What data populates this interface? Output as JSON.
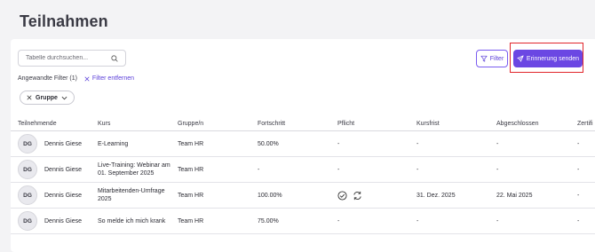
{
  "page": {
    "title": "Teilnahmen"
  },
  "toolbar": {
    "search_placeholder": "Tabelle durchsuchen...",
    "filter_label": "Filter",
    "send_reminder_label": "Erinnerung senden"
  },
  "filters": {
    "applied_label": "Angewandte Filter (1)",
    "clear_label": "Filter entfernen",
    "chips": [
      "Gruppe"
    ]
  },
  "table": {
    "columns": [
      "Teilnehmende",
      "Kurs",
      "Gruppe/n",
      "Fortschritt",
      "Pflicht",
      "Kursfrist",
      "Abgeschlossen",
      "Zertifi"
    ],
    "rows": [
      {
        "initials": "DG",
        "name": "Dennis Giese",
        "course": "E-Learning",
        "group": "Team HR",
        "progress": "50.00%",
        "mandatory": "-",
        "deadline": "-",
        "completed": "-",
        "certificate": "-"
      },
      {
        "initials": "DG",
        "name": "Dennis Giese",
        "course": "Live-Training: Webinar am 01. September 2025",
        "group": "Team HR",
        "progress": "-",
        "mandatory": "-",
        "deadline": "-",
        "completed": "-",
        "certificate": "-"
      },
      {
        "initials": "DG",
        "name": "Dennis Giese",
        "course": "Mitarbeitenden-Umfrage 2025",
        "group": "Team HR",
        "progress": "100.00%",
        "mandatory": "",
        "deadline": "31. Dez. 2025",
        "completed": "22. Mai 2025",
        "certificate": "-"
      },
      {
        "initials": "DG",
        "name": "Dennis Giese",
        "course": "So melde ich mich krank",
        "group": "Team HR",
        "progress": "75.00%",
        "mandatory": "-",
        "deadline": "-",
        "completed": "-",
        "certificate": "-"
      }
    ]
  },
  "colors": {
    "accent": "#6b47e3",
    "highlight": "#e1252b"
  }
}
